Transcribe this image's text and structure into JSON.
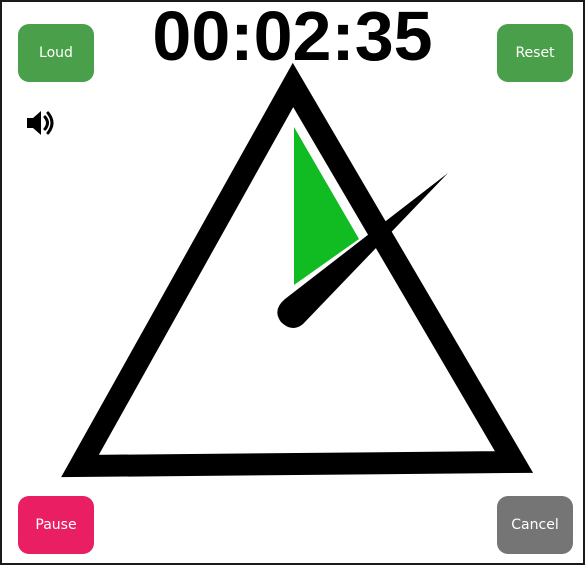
{
  "timer": {
    "display": "00:02:35"
  },
  "buttons": {
    "loud": "Loud",
    "reset": "Reset",
    "pause": "Pause",
    "cancel": "Cancel"
  },
  "icons": {
    "volume": "speaker-volume-icon"
  },
  "colors": {
    "green_button": "#4aa04a",
    "pause_button": "#e91e63",
    "cancel_button": "#757575",
    "progress_wedge": "#11bb22",
    "outline": "#000000"
  }
}
